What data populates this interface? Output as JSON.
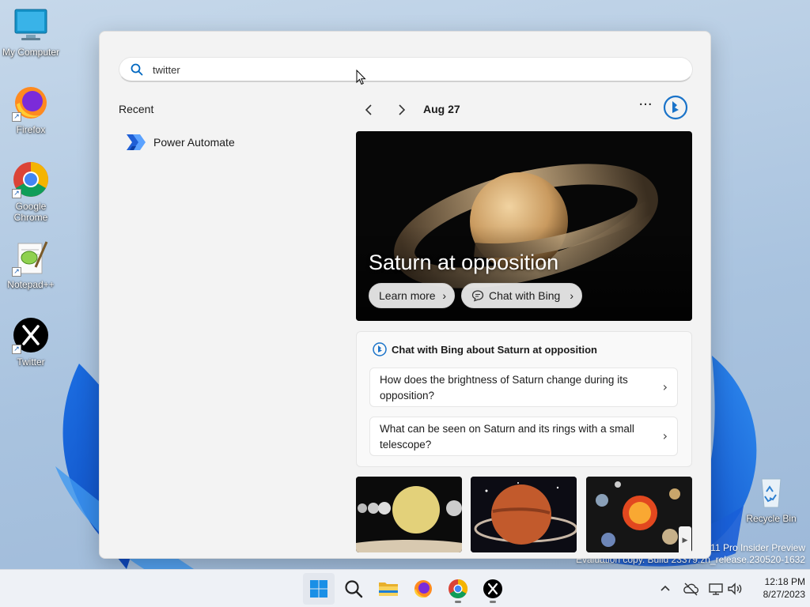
{
  "desktop": {
    "icons": [
      {
        "label": "My Computer",
        "icon": "computer-icon"
      },
      {
        "label": "Firefox",
        "icon": "firefox-icon"
      },
      {
        "label": "Google Chrome",
        "icon": "chrome-icon"
      },
      {
        "label": "Notepad++",
        "icon": "notepadpp-icon"
      },
      {
        "label": "Twitter",
        "icon": "x-icon"
      },
      {
        "label": "Recycle Bin",
        "icon": "recycle-bin-icon"
      }
    ]
  },
  "search": {
    "query": "twitter",
    "recent_heading": "Recent",
    "recent_items": [
      {
        "label": "Power Automate",
        "icon": "power-automate-icon"
      }
    ],
    "date": "Aug 27",
    "more_label": "···",
    "hero": {
      "title": "Saturn at opposition",
      "learn_more": "Learn more",
      "chat_with_bing": "Chat with Bing"
    },
    "chat_card": {
      "heading": "Chat with Bing about Saturn at opposition",
      "questions": [
        "How does the brightness of Saturn change during its opposition?",
        "What can be seen on Saturn and its rings with a small telescope?"
      ]
    }
  },
  "watermark": {
    "line1": "11 Pro Insider Preview",
    "line2": "Evaluation copy. Build 23379.zn_release.230520-1632"
  },
  "taskbar": {
    "apps": [
      "start-icon",
      "search-icon",
      "file-explorer-icon",
      "firefox-icon",
      "chrome-icon",
      "x-icon"
    ],
    "tray": [
      "chevron-up-icon",
      "onedrive-icon",
      "network-icon",
      "volume-icon"
    ],
    "time": "12:18 PM",
    "date": "8/27/2023"
  },
  "colors": {
    "accent": "#0067c0",
    "bing": "#1a73c9",
    "power_automate": "#1f5fd6"
  }
}
